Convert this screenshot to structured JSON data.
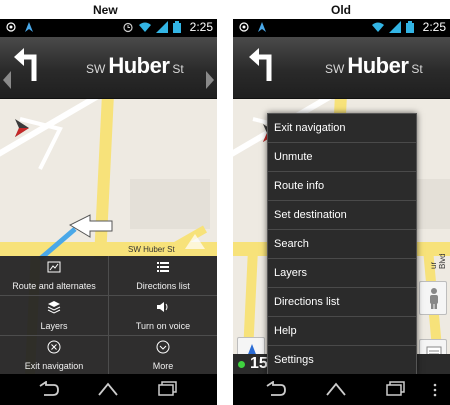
{
  "captions": {
    "new": "New",
    "old": "Old"
  },
  "status_bar": {
    "time": "2:25"
  },
  "turn_banner": {
    "prefix": "SW",
    "street": "Huber",
    "suffix": "St"
  },
  "map": {
    "street_label": "SW Huber St",
    "side_street_label": "ur Blvd",
    "speed_fragment": "15"
  },
  "new_menu": {
    "items": [
      {
        "label": "Route and alternates",
        "icon": "route-icon"
      },
      {
        "label": "Directions list",
        "icon": "list-icon"
      },
      {
        "label": "Layers",
        "icon": "layers-icon"
      },
      {
        "label": "Turn on voice",
        "icon": "speaker-icon"
      },
      {
        "label": "Exit navigation",
        "icon": "close-circle-icon"
      },
      {
        "label": "More",
        "icon": "chevron-down-icon"
      }
    ]
  },
  "old_menu": {
    "items": [
      {
        "label": "Exit navigation"
      },
      {
        "label": "Unmute"
      },
      {
        "label": "Route info"
      },
      {
        "label": "Set destination"
      },
      {
        "label": "Search"
      },
      {
        "label": "Layers"
      },
      {
        "label": "Directions list"
      },
      {
        "label": "Help"
      },
      {
        "label": "Settings"
      }
    ]
  },
  "colors": {
    "road": "#f7e27a",
    "route": "#4aa8e8",
    "menu_bg": "#2b2b2b",
    "map_bg": "#eeeae2"
  }
}
